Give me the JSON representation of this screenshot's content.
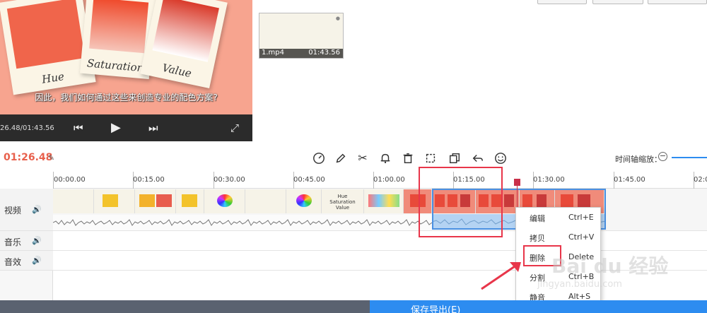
{
  "preview": {
    "polaroid_labels": [
      "Hue",
      "Saturation",
      "Value"
    ],
    "subtitle": "因此，我们如何通过这些来创造专业的配色方案?",
    "time_display": "26.48/01:43.56"
  },
  "media": {
    "clip_name": "1.mp4",
    "clip_duration": "01:43.56"
  },
  "toolbar": {
    "current_time": "01:26.48",
    "zoom_label": "时间轴缩放：",
    "zoom_minus": "−",
    "tools": [
      "speed-icon",
      "pencil-icon",
      "scissors-icon",
      "bell-icon",
      "trash-icon",
      "crop-icon",
      "copy-icon",
      "undo-icon",
      "emoji-icon"
    ]
  },
  "timeline": {
    "ticks": [
      "00:00.00",
      "00:15.00",
      "00:30.00",
      "00:45.00",
      "01:00.00",
      "01:15.00",
      "01:30.00",
      "01:45.00",
      "02:0"
    ],
    "tracks": [
      "视频",
      "音乐",
      "音效"
    ],
    "title_card": [
      "Hue",
      "Saturation",
      "Value"
    ],
    "playhead": "01:26.48"
  },
  "context_menu": {
    "items": [
      {
        "label": "编辑",
        "shortcut": "Ctrl+E"
      },
      {
        "label": "拷贝",
        "shortcut": "Ctrl+V"
      },
      {
        "label": "删除",
        "shortcut": "Delete"
      },
      {
        "label": "分割",
        "shortcut": "Ctrl+B"
      },
      {
        "label": "静音",
        "shortcut": "Alt+S"
      }
    ]
  },
  "footer": {
    "label": "保存导出(E)"
  },
  "watermark": {
    "main": "Bai du 经验",
    "sub": "jingyan.baidu.com"
  },
  "colors": {
    "accent": "#2d8cf0",
    "time": "#e8604c",
    "highlight": "#e8364a",
    "playhead": "#c9304a"
  }
}
